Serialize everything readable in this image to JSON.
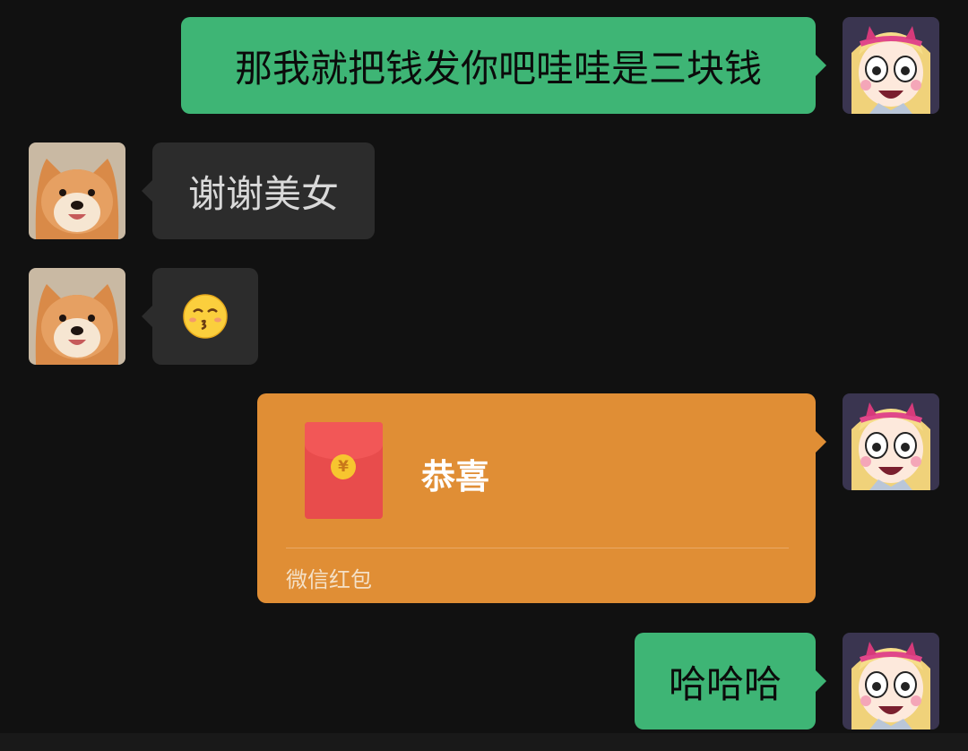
{
  "messages": [
    {
      "sender": "me",
      "type": "text",
      "text": "那我就把钱发你吧哇哇是三块钱"
    },
    {
      "sender": "friend",
      "type": "text",
      "text": "谢谢美女"
    },
    {
      "sender": "friend",
      "type": "emoji",
      "emoji": "kissing-face-with-smiling-eyes",
      "text": "😙"
    },
    {
      "sender": "me",
      "type": "red-packet",
      "title": "恭喜",
      "footer": "微信红包",
      "coin_symbol": "¥"
    },
    {
      "sender": "me",
      "type": "text",
      "text": "哈哈哈"
    }
  ],
  "avatars": {
    "me": "cartoon-girl-avatar",
    "friend": "shiba-dog-avatar"
  },
  "colors": {
    "background": "#111111",
    "my_bubble": "#3eb575",
    "friend_bubble": "#2c2c2c",
    "red_packet": "#e08e35",
    "envelope": "#e84c4c"
  }
}
